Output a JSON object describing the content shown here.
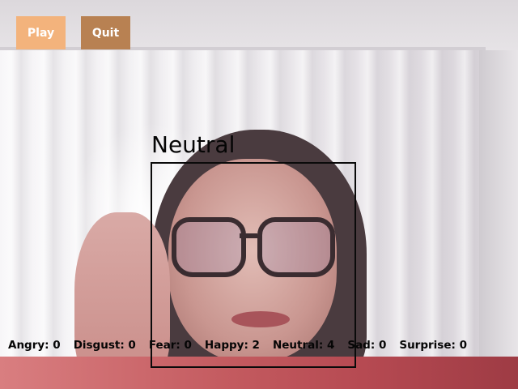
{
  "buttons": {
    "play": {
      "label": "Play",
      "color": "#f3b37c"
    },
    "quit": {
      "label": "Quit",
      "color": "#b88152"
    }
  },
  "detection": {
    "label": "Neutral",
    "box_color": "#0a0a0a"
  },
  "emotion_counts": [
    {
      "text": "Angry: 0"
    },
    {
      "text": "Disgust: 0"
    },
    {
      "text": "Fear: 0"
    },
    {
      "text": "Happy: 2"
    },
    {
      "text": "Neutral: 4"
    },
    {
      "text": "Sad: 0"
    },
    {
      "text": "Surprise: 0"
    }
  ]
}
